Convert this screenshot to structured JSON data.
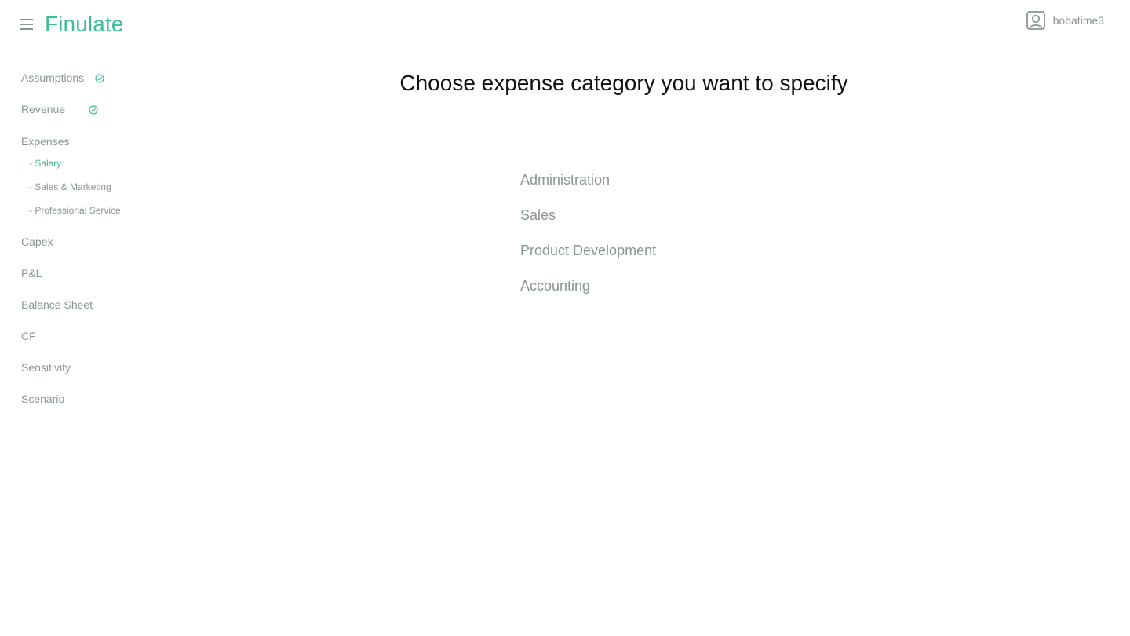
{
  "app": {
    "brand": "Finulate",
    "accent_color": "#3dbe98"
  },
  "header": {
    "menu_icon": "hamburger-menu-icon",
    "user_icon": "user-avatar-icon",
    "username": "bobatime3"
  },
  "sidebar": {
    "items": [
      {
        "label": "Assumptions",
        "completed": true
      },
      {
        "label": "Revenue",
        "completed": true
      },
      {
        "label": "Expenses",
        "completed": false
      },
      {
        "label": "Capex",
        "completed": false
      },
      {
        "label": "P&L",
        "completed": false
      },
      {
        "label": "Balance Sheet",
        "completed": false
      },
      {
        "label": "CF",
        "completed": false
      },
      {
        "label": "Sensitivity",
        "completed": false
      },
      {
        "label": "Scenario",
        "completed": false
      }
    ],
    "expenses_subitems": [
      {
        "label": "- Salary",
        "active": true
      },
      {
        "label": "- Sales & Marketing",
        "active": false
      },
      {
        "label": "- Professional Service",
        "active": false
      }
    ],
    "check_icon": "check-circle-icon"
  },
  "main": {
    "title": "Choose expense category you want to specify",
    "categories": [
      "Administration",
      "Sales",
      "Product Development",
      "Accounting"
    ]
  }
}
